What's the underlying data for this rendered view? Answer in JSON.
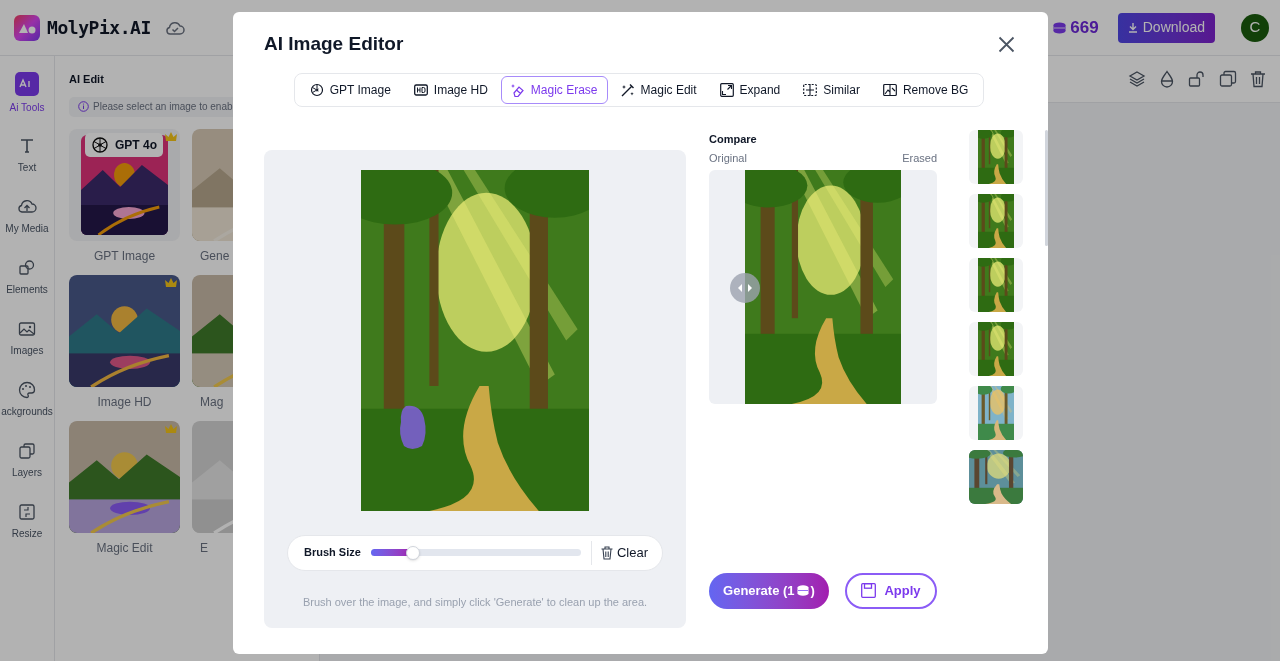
{
  "app": {
    "logo": "MolyPix.AI",
    "coins": "669",
    "download": "Download",
    "avatar": "C"
  },
  "rail": [
    {
      "label": "Ai Tools",
      "selected": true
    },
    {
      "label": "Text",
      "selected": false
    },
    {
      "label": "My Media",
      "selected": false
    },
    {
      "label": "Elements",
      "selected": false
    },
    {
      "label": "Images",
      "selected": false
    },
    {
      "label": "ackgrounds",
      "selected": false
    },
    {
      "label": "Layers",
      "selected": false
    },
    {
      "label": "Resize",
      "selected": false
    }
  ],
  "panel": {
    "title": "AI Edit",
    "notice": "Please select an image to enab",
    "cards": [
      {
        "label": "GPT Image",
        "badge": "GPT 4o",
        "premium": true
      },
      {
        "label": "Gene"
      },
      {
        "label": "Image HD",
        "premium": true
      },
      {
        "label": "Mag"
      },
      {
        "label": "Magic Edit",
        "premium": true
      },
      {
        "label": "E"
      }
    ]
  },
  "editor": {
    "title": "AI Image Editor",
    "tabs": [
      {
        "label": "GPT Image",
        "selected": false
      },
      {
        "label": "Image HD",
        "selected": false
      },
      {
        "label": "Magic Erase",
        "selected": true
      },
      {
        "label": "Magic Edit",
        "selected": false
      },
      {
        "label": "Expand",
        "selected": false
      },
      {
        "label": "Similar",
        "selected": false
      },
      {
        "label": "Remove BG",
        "selected": false
      }
    ],
    "brush": {
      "label": "Brush Size",
      "level": 0.2
    },
    "clear": "Clear",
    "hint": "Brush over the image, and simply click 'Generate' to clean up the area.",
    "compare": {
      "title": "Compare",
      "left": "Original",
      "right": "Erased"
    },
    "generate": {
      "label": "Generate (1",
      "suffix": ")"
    },
    "apply": "Apply"
  }
}
